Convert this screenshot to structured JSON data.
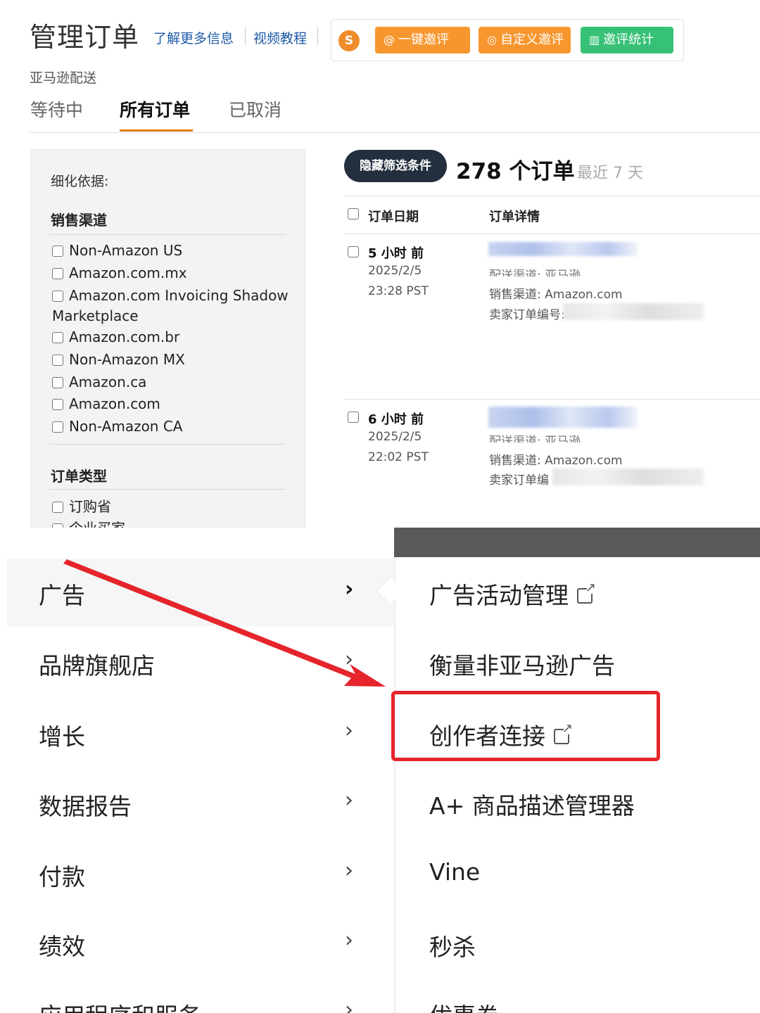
{
  "orders_page": {
    "title": "管理订单",
    "links": [
      "了解更多信息",
      "视频教程"
    ],
    "plugin": {
      "logo_letter": "S",
      "buttons": [
        {
          "icon": "at-icon",
          "label": "一键邀评",
          "color": "#f7962f"
        },
        {
          "icon": "target-icon",
          "label": "自定义邀评",
          "color": "#f7962f"
        },
        {
          "icon": "bar-chart-icon",
          "label": "邀评统计",
          "color": "#36c176"
        }
      ]
    },
    "fulfillment_label": "亚马逊配送",
    "tabs": [
      {
        "label": "等待中",
        "active": false
      },
      {
        "label": "所有订单",
        "active": true
      },
      {
        "label": "已取消",
        "active": false
      }
    ],
    "filters": {
      "title": "细化依据:",
      "sales_channel_heading": "销售渠道",
      "sales_channels": [
        "Non-Amazon US",
        "Amazon.com.mx",
        "Amazon.com Invoicing Shadow Marketplace",
        "Amazon.com.br",
        "Non-Amazon MX",
        "Amazon.ca",
        "Amazon.com",
        "Non-Amazon CA"
      ],
      "order_type_heading": "订单类型",
      "order_types": [
        "订购省",
        "企业买家"
      ]
    },
    "list": {
      "hide_filters_button": "隐藏筛选条件",
      "count_text": "278 个订单",
      "range_text": "最近 7 天",
      "columns": [
        "订单日期",
        "订单详情"
      ],
      "rows": [
        {
          "relative_time": "5 小时 前",
          "date": "2025/2/5",
          "time": "23:28 PST",
          "delivery_channel": "配送渠道: 亚马逊",
          "sales_channel": "销售渠道: Amazon.com",
          "seller_order_label": "卖家订单编号:"
        },
        {
          "relative_time": "6 小时 前",
          "date": "2025/2/5",
          "time": "22:02 PST",
          "delivery_channel": "配送渠道: 亚马逊",
          "sales_channel": "销售渠道: Amazon.com",
          "seller_order_label": "卖家订单编"
        }
      ]
    }
  },
  "nav_menu": {
    "main_items": [
      {
        "label": "广告",
        "active": true
      },
      {
        "label": "品牌旗舰店",
        "active": false
      },
      {
        "label": "增长",
        "active": false
      },
      {
        "label": "数据报告",
        "active": false
      },
      {
        "label": "付款",
        "active": false
      },
      {
        "label": "绩效",
        "active": false
      },
      {
        "label": "应用程序和服务",
        "active": false
      }
    ],
    "chevron": "›",
    "sub_items": [
      {
        "label": "广告活动管理",
        "external": true
      },
      {
        "label": "衡量非亚马逊广告",
        "external": false
      },
      {
        "label": "创作者连接",
        "external": true,
        "highlighted": true
      },
      {
        "label": "A+ 商品描述管理器",
        "external": false
      },
      {
        "label": "Vine",
        "external": false
      },
      {
        "label": "秒杀",
        "external": false
      },
      {
        "label": "优惠券",
        "external": false
      }
    ],
    "annotation_color": "#e5242b"
  }
}
